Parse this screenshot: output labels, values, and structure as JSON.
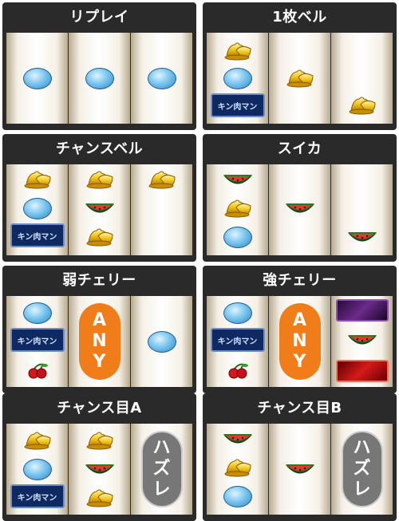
{
  "panels": [
    {
      "title": "リプレイ"
    },
    {
      "title": "1枚ベル"
    },
    {
      "title": "チャンスベル"
    },
    {
      "title": "スイカ"
    },
    {
      "title": "弱チェリー"
    },
    {
      "title": "強チェリー"
    },
    {
      "title": "チャンス目A"
    },
    {
      "title": "チャンス目B"
    }
  ],
  "labels": {
    "any": [
      "A",
      "N",
      "Y"
    ],
    "hazure": [
      "ハ",
      "ズ",
      "レ"
    ],
    "bar_text": "キン肉マン"
  },
  "colors": {
    "panel_bg": "#2a2a2a",
    "any_pill": "#f07d1a",
    "hazure_pill": "#777777"
  }
}
